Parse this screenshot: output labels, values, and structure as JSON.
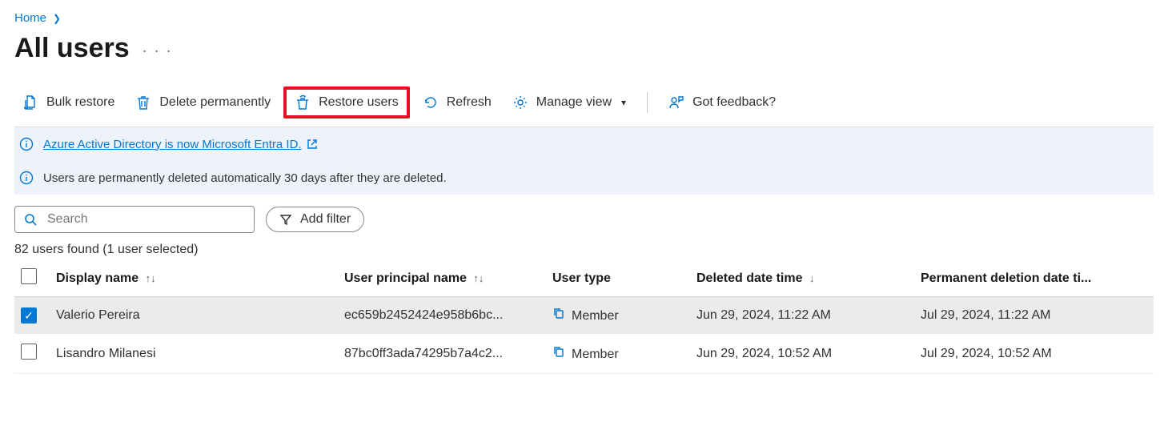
{
  "breadcrumb": {
    "home": "Home"
  },
  "title": "All users",
  "toolbar": {
    "bulk_restore": "Bulk restore",
    "delete_permanently": "Delete permanently",
    "restore_users": "Restore users",
    "refresh": "Refresh",
    "manage_view": "Manage view",
    "feedback": "Got feedback?"
  },
  "banners": {
    "rename": "Azure Active Directory is now Microsoft Entra ID.",
    "perm_delete": "Users are permanently deleted automatically 30 days after they are deleted."
  },
  "search": {
    "placeholder": "Search"
  },
  "filter": {
    "add": "Add filter"
  },
  "summary": "82 users found (1 user selected)",
  "columns": {
    "display_name": "Display name",
    "upn": "User principal name",
    "user_type": "User type",
    "deleted": "Deleted date time",
    "perm": "Permanent deletion date ti..."
  },
  "rows": [
    {
      "selected": true,
      "display_name": "Valerio Pereira",
      "upn": "ec659b2452424e958b6bc...",
      "user_type": "Member",
      "deleted": "Jun 29, 2024, 11:22 AM",
      "perm": "Jul 29, 2024, 11:22 AM"
    },
    {
      "selected": false,
      "display_name": "Lisandro Milanesi",
      "upn": "87bc0ff3ada74295b7a4c2...",
      "user_type": "Member",
      "deleted": "Jun 29, 2024, 10:52 AM",
      "perm": "Jul 29, 2024, 10:52 AM"
    }
  ]
}
